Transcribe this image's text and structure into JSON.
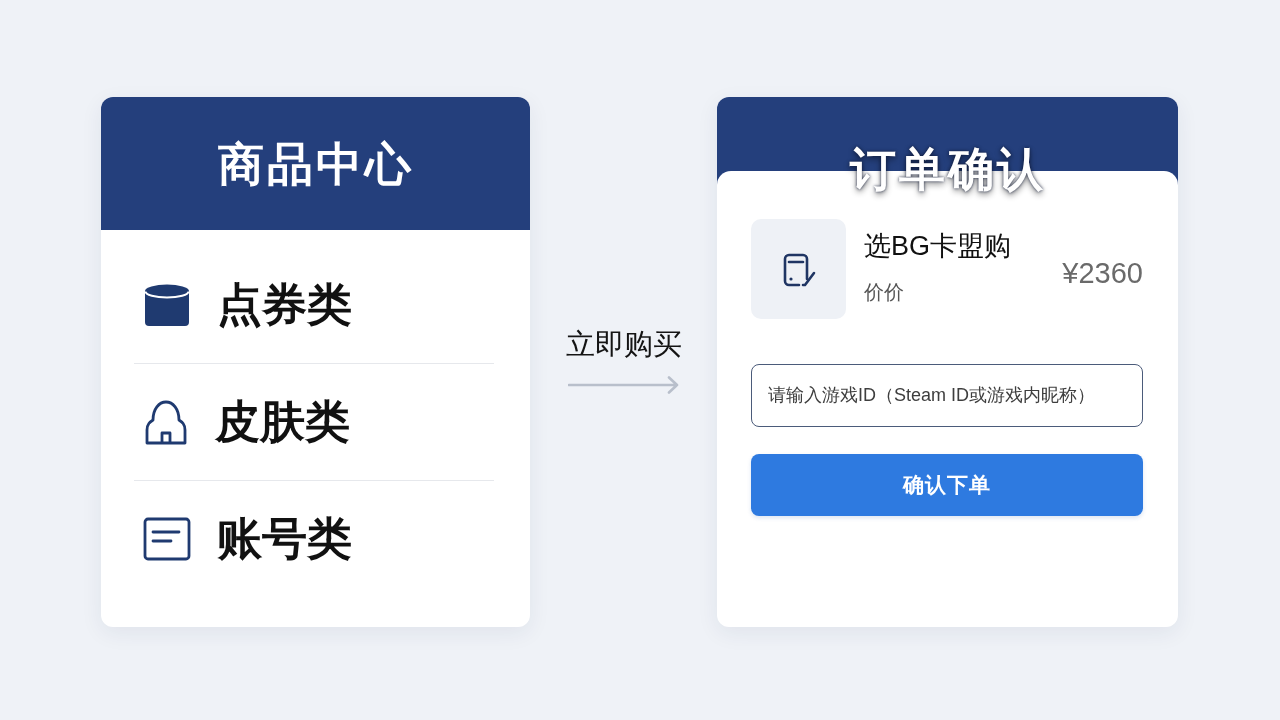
{
  "left_panel": {
    "title": "商品中心",
    "items": [
      {
        "label": "点券类"
      },
      {
        "label": "皮肤类"
      },
      {
        "label": "账号类"
      }
    ]
  },
  "buy_action": {
    "label": "立即购买"
  },
  "right_panel": {
    "title": "订单确认",
    "product": {
      "name": "选BG卡盟购",
      "subtitle": "价价",
      "price": "¥2360"
    },
    "game_id_field": {
      "placeholder": "请输入游戏ID（Steam ID或游戏内昵称）"
    },
    "submit_button": {
      "label": "确认下单"
    }
  }
}
